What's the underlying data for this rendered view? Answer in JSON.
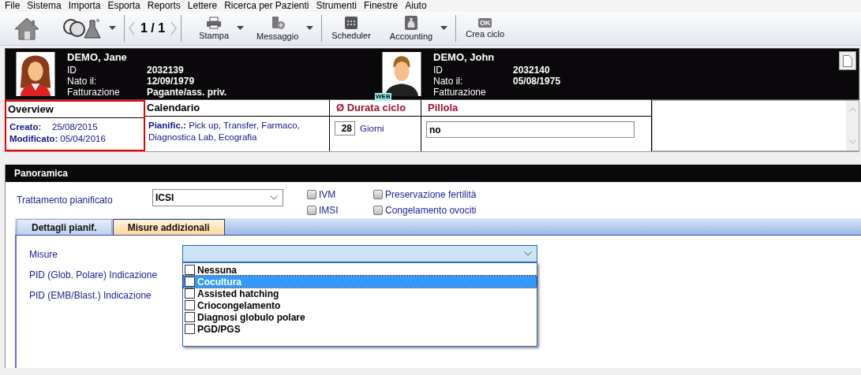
{
  "menu": [
    "File",
    "Sistema",
    "Importa",
    "Esporta",
    "Reports",
    "Lettere",
    "Ricerca per Pazienti",
    "Strumenti",
    "Finestre",
    "Aiuto"
  ],
  "toolbar": {
    "pager": "1 / 1",
    "buttons": [
      {
        "kind": "home"
      },
      {
        "kind": "people",
        "dropdown": true
      },
      {
        "kind": "pager"
      },
      {
        "kind": "print",
        "label": "Stampa",
        "dropdown": true
      },
      {
        "kind": "message",
        "label": "Messaggio",
        "dropdown": true
      },
      {
        "kind": "scheduler",
        "label": "Scheduler"
      },
      {
        "kind": "accounting",
        "label": "Accounting",
        "dropdown": true
      },
      {
        "kind": "ok",
        "label": "Crea ciclo",
        "badge": "OK"
      }
    ]
  },
  "patients": [
    {
      "name": "DEMO, Jane",
      "kind": "female",
      "fields": [
        {
          "label": "ID",
          "value": "2032139"
        },
        {
          "label": "Nato il:",
          "value": "12/09/1979"
        },
        {
          "label": "Fatturazione",
          "value": "Pagante/ass. priv."
        }
      ]
    },
    {
      "name": "DEMO, John",
      "kind": "male",
      "badge": "WEB",
      "fields": [
        {
          "label": "ID",
          "value": "2032140"
        },
        {
          "label": "Nato il:",
          "value": "05/08/1975"
        },
        {
          "label": "Fatturazione"
        }
      ]
    }
  ],
  "info": {
    "overview": {
      "title": "Overview",
      "highlighted": true,
      "rows": [
        {
          "label": "Creato:",
          "value": "25/08/2015"
        },
        {
          "label": "Modificato:",
          "value": "05/04/2016"
        }
      ]
    },
    "calendario": {
      "title": "Calendario",
      "label": "Pianific.:",
      "text": "Pick up, Transfer, Farmaco, Diagnostica Lab, Ecografia"
    },
    "durata": {
      "title": "Ø Durata ciclo",
      "value": "28",
      "unit": "Giorni"
    },
    "pillola": {
      "title": "Pillola",
      "value": "no"
    }
  },
  "panel": {
    "title": "Panoramica",
    "treatment": {
      "label": "Trattamento pianificato",
      "value": "ICSI"
    },
    "options": [
      {
        "label": "IVM",
        "checked": false
      },
      {
        "label": "IMSI",
        "checked": false
      },
      {
        "label": "Preservazione fertilità",
        "checked": false
      },
      {
        "label": "Congelamento ovociti",
        "checked": false
      }
    ],
    "tabs": [
      {
        "label": "Dettagli pianif.",
        "selected": false
      },
      {
        "label": "Misure addizionali",
        "selected": true
      }
    ],
    "fields": [
      {
        "label": "Misure",
        "kind": "dropdown",
        "open": true
      },
      {
        "label": "PID (Glob. Polare) Indicazione"
      },
      {
        "label": "PID (EMB/Blast.) Indicazione"
      }
    ],
    "misure_options": [
      {
        "label": "Nessuna",
        "checked": false,
        "selected": false
      },
      {
        "label": "Cocultura",
        "checked": false,
        "selected": true
      },
      {
        "label": "Assisted hatching",
        "checked": false,
        "selected": false
      },
      {
        "label": "Criocongelamento",
        "checked": false,
        "selected": false
      },
      {
        "label": "Diagnosi globulo polare",
        "checked": false,
        "selected": false
      },
      {
        "label": "PGD/PGS",
        "checked": false,
        "selected": false
      }
    ]
  }
}
